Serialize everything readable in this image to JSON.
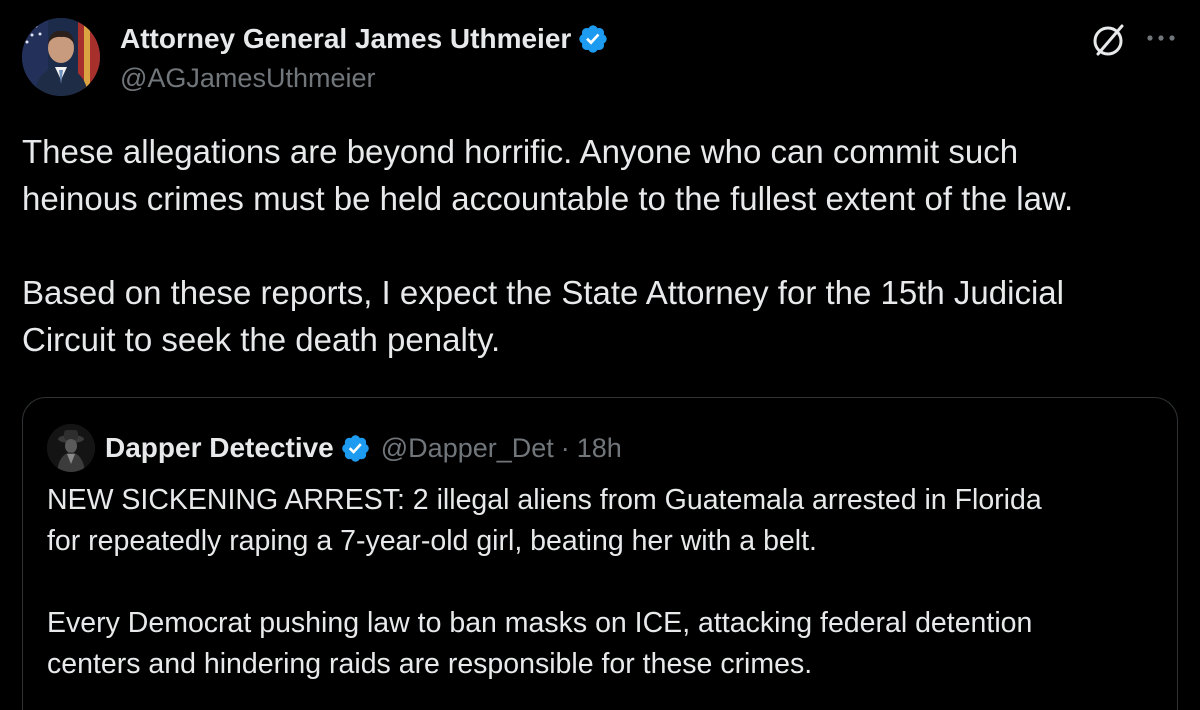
{
  "tweet": {
    "author": {
      "display_name": "Attorney General James Uthmeier",
      "handle": "@AGJamesUthmeier",
      "verified_color": "#1d9bf0"
    },
    "icons": [
      "grok-icon",
      "more-icon"
    ],
    "text_paragraphs": [
      [
        "These allegations are beyond horrific. Anyone who can commit such",
        "heinous crimes must be held accountable to the fullest extent of the law."
      ],
      [
        "Based on these reports, I expect the State Attorney for the 15th Judicial",
        "Circuit to seek the death penalty."
      ]
    ]
  },
  "quoted_tweet": {
    "author": {
      "display_name": "Dapper Detective",
      "handle": "@Dapper_Det",
      "separator": "·",
      "time": "18h"
    },
    "text_paragraphs": [
      [
        "NEW SICKENING ARREST: 2 illegal aliens from Guatemala arrested in Florida",
        "for repeatedly raping a 7-year-old girl, beating her with a belt."
      ],
      [
        "Every Democrat pushing law to ban masks on ICE, attacking federal detention",
        "centers and hindering raids are responsible for these crimes."
      ]
    ]
  },
  "colors": {
    "background": "#000000",
    "text_primary": "#e7e9ea",
    "text_secondary": "#71767b",
    "border": "#2f3336",
    "accent": "#1d9bf0"
  }
}
